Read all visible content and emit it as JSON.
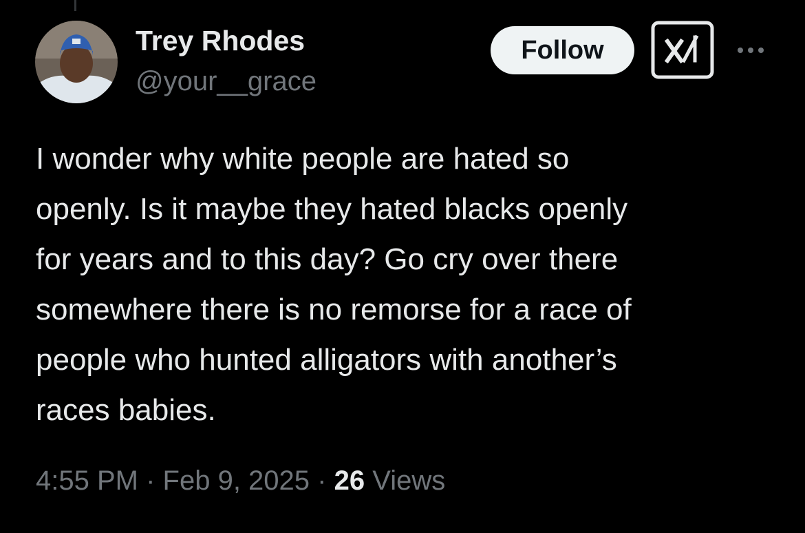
{
  "author": {
    "display_name": "Trey Rhodes",
    "handle": "@your__grace"
  },
  "actions": {
    "follow_label": "Follow",
    "grok_icon": "grok-icon",
    "more_icon": "more-icon"
  },
  "tweet": {
    "lines": [
      "I wonder why white people are hated so",
      "openly. Is it maybe they hated blacks openly",
      "for years and to this day? Go cry over there",
      "somewhere there is no remorse for a race of",
      "people who hunted alligators with another’s",
      "races babies."
    ]
  },
  "meta": {
    "time": "4:55 PM",
    "date": "Feb 9, 2025",
    "separator": "·",
    "views_count": "26",
    "views_label": "Views"
  },
  "colors": {
    "background": "#000000",
    "text_primary": "#e7e9ea",
    "text_secondary": "#71767b",
    "follow_bg": "#eff3f4",
    "follow_text": "#0f1419"
  }
}
